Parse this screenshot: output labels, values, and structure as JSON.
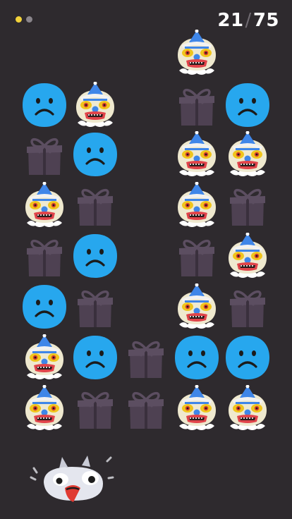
{
  "hud": {
    "page_dots": [
      {
        "color": "#f2d23a",
        "active": true
      },
      {
        "color": "#8a858b",
        "active": false
      }
    ],
    "score_current": "21",
    "score_separator": "/",
    "score_total": "75"
  },
  "board": {
    "columns": 5,
    "rows": 8,
    "cells": [
      [
        null,
        null,
        null,
        "clown",
        null
      ],
      [
        "sad-face",
        "clown",
        null,
        "gift",
        "sad-face"
      ],
      [
        "gift",
        "sad-face",
        null,
        "clown",
        "clown"
      ],
      [
        "clown",
        "gift",
        null,
        "clown",
        "gift"
      ],
      [
        "gift",
        "sad-face",
        null,
        "gift",
        "clown"
      ],
      [
        "sad-face",
        "gift",
        null,
        "clown",
        "gift"
      ],
      [
        "clown",
        "sad-face",
        "gift",
        "sad-face",
        "sad-face"
      ],
      [
        "clown",
        "gift",
        "gift",
        "clown",
        "clown"
      ]
    ]
  },
  "colors": {
    "background": "#2e2a2e",
    "sad_face": "#27a7ee",
    "gift": "#4e4152",
    "clown_face": "#efe9cf",
    "clown_hat": "#3f86e8",
    "clown_mouth": "#e0444a"
  },
  "mascot": {
    "icon": "goofy-bird-icon"
  }
}
